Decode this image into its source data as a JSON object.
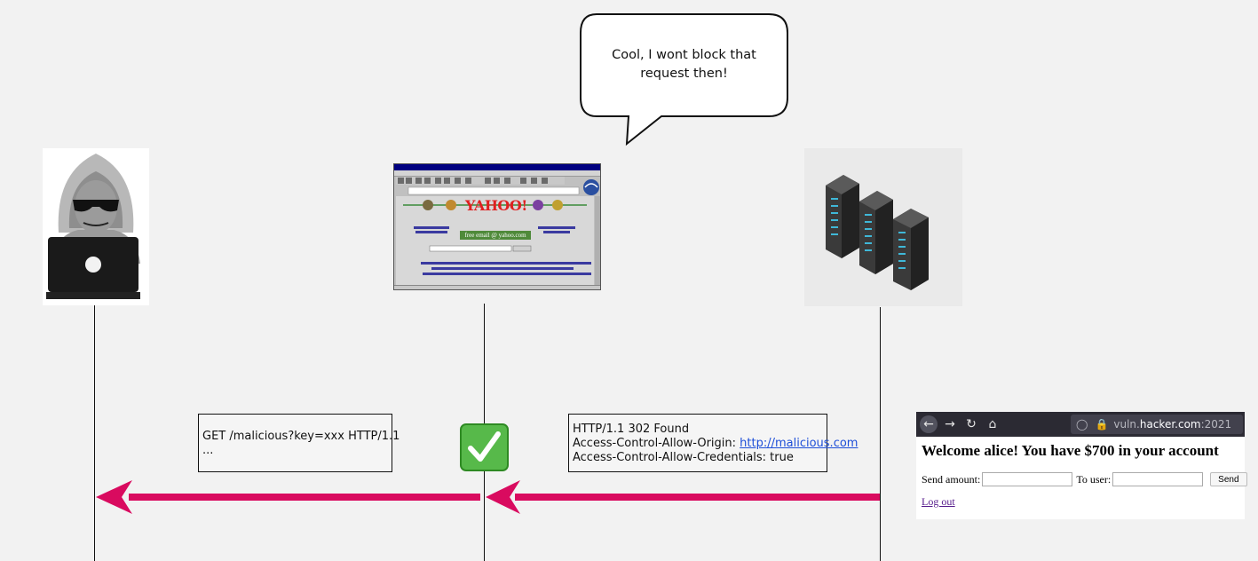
{
  "speech_bubble": {
    "line1": "Cool, I wont block that",
    "line2": "request then!"
  },
  "request_note": {
    "line1": "GET /malicious?key=xxx HTTP/1.1",
    "line2": "..."
  },
  "response_note": {
    "line1": "HTTP/1.1 302 Found",
    "line2_prefix": "Access-Control-Allow-Origin: ",
    "line2_link": "http://malicious.com",
    "line3": "Access-Control-Allow-Credentials: true"
  },
  "bank_page": {
    "url_host_prefix": "vuln.",
    "url_host_main": "hacker.com",
    "url_port": ":2021",
    "heading": "Welcome alice! You have $700 in your account",
    "send_amount_label": "Send amount:",
    "to_user_label": "To user:",
    "send_button": "Send",
    "logout_link": "Log out"
  },
  "yahoo_window": {
    "logo": "YAHOO!",
    "mail_banner": "free email @ yahoo.com"
  },
  "colors": {
    "arrow": "#d90b5f",
    "background": "#f2f2f2",
    "check_green": "#57b94a"
  },
  "icons": [
    "hacker-icon",
    "browser-window-icon",
    "server-rack-icon",
    "checkmark-icon"
  ]
}
